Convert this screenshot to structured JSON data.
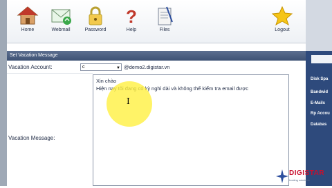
{
  "toolbar": {
    "items": [
      {
        "label": "Home",
        "icon": "home-icon"
      },
      {
        "label": "Webmail",
        "icon": "webmail-icon"
      },
      {
        "label": "Password",
        "icon": "lock-icon"
      },
      {
        "label": "Help",
        "icon": "question-icon"
      },
      {
        "label": "Files",
        "icon": "files-icon"
      },
      {
        "label": "Logout",
        "icon": "star-icon"
      }
    ]
  },
  "section": {
    "title": "Set Vacation Message"
  },
  "form": {
    "account_label": "Vacation Account:",
    "account_value": "c",
    "account_domain": "@demo2.digistar.vn",
    "message_label": "Vacation Message:",
    "message_line1": "Xin chào",
    "message_line2": "Hiện nay tôi đang có kỳ nghỉ dài và không thể kiểm tra email được"
  },
  "sidebar": {
    "items": [
      "Disk Spa",
      "Bandwid",
      "E-Mails",
      "Rp Accou",
      "Databas"
    ]
  },
  "logo": {
    "text": "DIGISTAR",
    "tagline": "hosting solutions"
  },
  "colors": {
    "header": "#3e5274",
    "sidebar": "#2e4a7c",
    "highlight": "#fff03c",
    "logo": "#c8102e"
  }
}
